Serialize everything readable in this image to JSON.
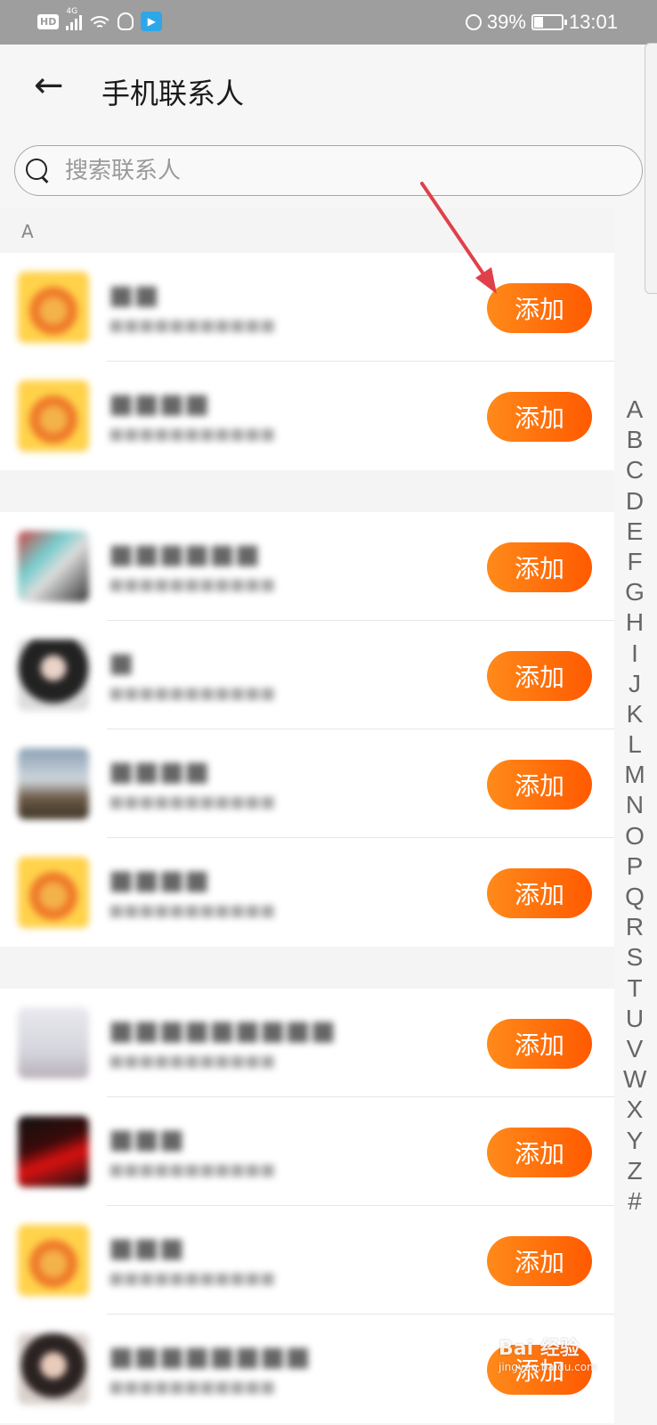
{
  "status_bar": {
    "hd": "HD",
    "network": "4G",
    "battery_percent": "39%",
    "time": "13:01",
    "icons": [
      "signal-icon",
      "wifi-icon",
      "qq-icon",
      "delivery-app-icon",
      "alarm-icon",
      "battery-icon"
    ]
  },
  "header": {
    "title": "手机联系人"
  },
  "search": {
    "placeholder": "搜索联系人"
  },
  "sections": [
    {
      "letter": "A",
      "items": [
        {
          "button": "添加"
        },
        {
          "button": "添加"
        }
      ]
    },
    {
      "letter": "",
      "items": [
        {
          "button": "添加"
        },
        {
          "button": "添加"
        },
        {
          "button": "添加"
        },
        {
          "button": "添加"
        }
      ]
    },
    {
      "letter": "",
      "items": [
        {
          "button": "添加"
        },
        {
          "button": "添加"
        },
        {
          "button": "添加"
        },
        {
          "button": "添加"
        }
      ]
    }
  ],
  "alpha_index": [
    "A",
    "B",
    "C",
    "D",
    "E",
    "F",
    "G",
    "H",
    "I",
    "J",
    "K",
    "L",
    "M",
    "N",
    "O",
    "P",
    "Q",
    "R",
    "S",
    "T",
    "U",
    "V",
    "W",
    "X",
    "Y",
    "Z",
    "#"
  ],
  "annotation": {
    "arrow_color": "#e0404a"
  },
  "watermark": {
    "text": "Bai 经验",
    "sub": "jingyan.baidu.com"
  },
  "colors": {
    "accent": "#ff6a0a",
    "status_bar": "#9e9e9e"
  }
}
